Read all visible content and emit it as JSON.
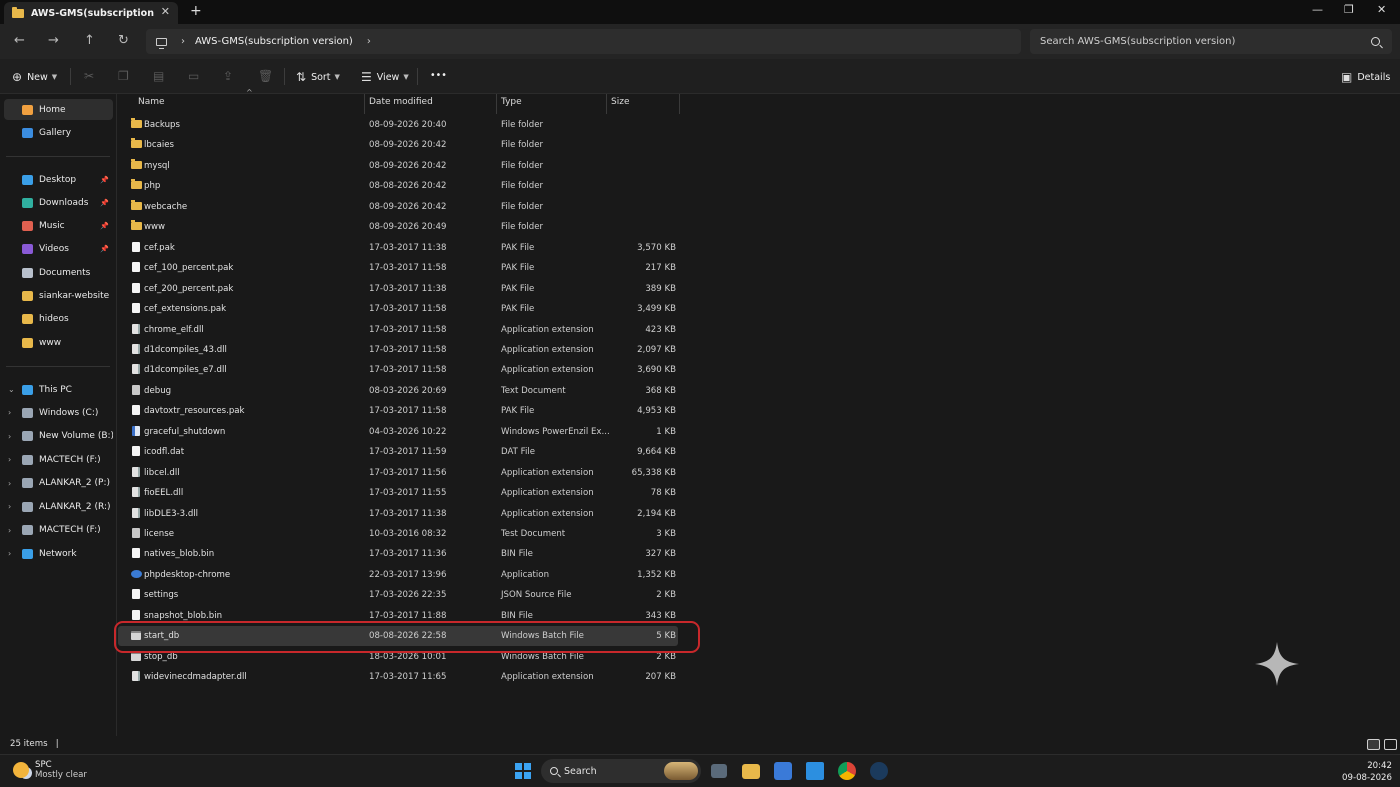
{
  "window": {
    "tab_title": "AWS-GMS(subscription version)",
    "tab_close": "✕",
    "new_tab": "+",
    "minimize": "—",
    "maximize": "❐",
    "close": "✕"
  },
  "address": {
    "path": "AWS-GMS(subscription version)",
    "search_placeholder": "Search AWS-GMS(subscription version)"
  },
  "commandbar": {
    "new_label": "New",
    "sort_label": "Sort",
    "view_label": "View",
    "more_label": "•••",
    "details_label": "Details"
  },
  "sidebar": {
    "quick": [
      {
        "label": "Home",
        "icon": "home-icon",
        "color": "#f0a040"
      },
      {
        "label": "Gallery",
        "icon": "gallery-icon",
        "color": "#3b8de0"
      }
    ],
    "pinned": [
      {
        "label": "Desktop",
        "icon": "desktop-icon",
        "color": "#3a9fe8",
        "pinned": true
      },
      {
        "label": "Downloads",
        "icon": "downloads-icon",
        "color": "#30b0a0",
        "pinned": true
      },
      {
        "label": "Music",
        "icon": "music-icon",
        "color": "#e06050",
        "pinned": true
      },
      {
        "label": "Videos",
        "icon": "videos-icon",
        "color": "#8a5ad6",
        "pinned": true
      },
      {
        "label": "Documents",
        "icon": "documents-icon",
        "color": "#b8c0cc",
        "pinned": false
      },
      {
        "label": "siankar-website",
        "icon": "folder-icon",
        "color": "#e8b84a",
        "pinned": false
      },
      {
        "label": "hideos",
        "icon": "folder-icon",
        "color": "#e8b84a",
        "pinned": false
      },
      {
        "label": "www",
        "icon": "folder-icon",
        "color": "#e8b84a",
        "pinned": false
      }
    ],
    "this_pc": {
      "label": "This PC",
      "icon": "pc-icon",
      "color": "#3a9fe8"
    },
    "drives": [
      {
        "label": "Windows (C:)",
        "icon": "drive-icon",
        "color": "#9aa6b4"
      },
      {
        "label": "New Volume (B:)",
        "icon": "drive-icon",
        "color": "#9aa6b4"
      },
      {
        "label": "MACTECH (F:)",
        "icon": "drive-icon",
        "color": "#9aa6b4"
      },
      {
        "label": "ALANKAR_2 (P:)",
        "icon": "drive-icon",
        "color": "#9aa6b4"
      }
    ],
    "roots": [
      {
        "label": "ALANKAR_2 (R:)",
        "icon": "drive-icon",
        "color": "#9aa6b4"
      },
      {
        "label": "MACTECH (F:)",
        "icon": "drive-icon",
        "color": "#9aa6b4"
      },
      {
        "label": "Network",
        "icon": "network-icon",
        "color": "#3a9fe8"
      }
    ]
  },
  "columns": {
    "name": "Name",
    "date": "Date modified",
    "type": "Type",
    "size": "Size"
  },
  "files": [
    {
      "name": "Backups",
      "date": "08-09-2026 20:40",
      "type": "File folder",
      "size": "",
      "kind": "folder"
    },
    {
      "name": "lbcaies",
      "date": "08-09-2026 20:42",
      "type": "File folder",
      "size": "",
      "kind": "folder"
    },
    {
      "name": "mysql",
      "date": "08-09-2026 20:42",
      "type": "File folder",
      "size": "",
      "kind": "folder"
    },
    {
      "name": "php",
      "date": "08-08-2026 20:42",
      "type": "File folder",
      "size": "",
      "kind": "folder"
    },
    {
      "name": "webcache",
      "date": "08-09-2026 20:42",
      "type": "File folder",
      "size": "",
      "kind": "folder"
    },
    {
      "name": "www",
      "date": "08-09-2026 20:49",
      "type": "File folder",
      "size": "",
      "kind": "folder"
    },
    {
      "name": "cef.pak",
      "date": "17-03-2017 11:38",
      "type": "PAK File",
      "size": "3,570 KB",
      "kind": "file"
    },
    {
      "name": "cef_100_percent.pak",
      "date": "17-03-2017 11:58",
      "type": "PAK File",
      "size": "217 KB",
      "kind": "file"
    },
    {
      "name": "cef_200_percent.pak",
      "date": "17-03-2017 11:38",
      "type": "PAK File",
      "size": "389 KB",
      "kind": "file"
    },
    {
      "name": "cef_extensions.pak",
      "date": "17-03-2017 11:58",
      "type": "PAK File",
      "size": "3,499 KB",
      "kind": "file"
    },
    {
      "name": "chrome_elf.dll",
      "date": "17-03-2017 11:58",
      "type": "Application extension",
      "size": "423 KB",
      "kind": "dll"
    },
    {
      "name": "d1dcompiles_43.dll",
      "date": "17-03-2017 11:58",
      "type": "Application extension",
      "size": "2,097 KB",
      "kind": "dll"
    },
    {
      "name": "d1dcompiles_e7.dll",
      "date": "17-03-2017 11:58",
      "type": "Application extension",
      "size": "3,690 KB",
      "kind": "dll"
    },
    {
      "name": "debug",
      "date": "08-03-2026 20:69",
      "type": "Text Document",
      "size": "368 KB",
      "kind": "text"
    },
    {
      "name": "davtoxtr_resources.pak",
      "date": "17-03-2017 11:58",
      "type": "PAK File",
      "size": "4,953 KB",
      "kind": "file"
    },
    {
      "name": "graceful_shutdown",
      "date": "04-03-2026 10:22",
      "type": "Windows PowerEnzil Ex...",
      "size": "1 KB",
      "kind": "ps"
    },
    {
      "name": "icodfl.dat",
      "date": "17-03-2017 11:59",
      "type": "DAT File",
      "size": "9,664 KB",
      "kind": "file"
    },
    {
      "name": "libcel.dll",
      "date": "17-03-2017 11:56",
      "type": "Application extension",
      "size": "65,338 KB",
      "kind": "dll"
    },
    {
      "name": "fioEEL.dll",
      "date": "17-03-2017 11:55",
      "type": "Application extension",
      "size": "78 KB",
      "kind": "dll"
    },
    {
      "name": "libDLE3-3.dll",
      "date": "17-03-2017 11:38",
      "type": "Application extension",
      "size": "2,194 KB",
      "kind": "dll"
    },
    {
      "name": "license",
      "date": "10-03-2016 08:32",
      "type": "Test Document",
      "size": "3 KB",
      "kind": "text"
    },
    {
      "name": "natives_blob.bin",
      "date": "17-03-2017 11:36",
      "type": "BIN File",
      "size": "327 KB",
      "kind": "file"
    },
    {
      "name": "phpdesktop-chrome",
      "date": "22-03-2017 13:96",
      "type": "Application",
      "size": "1,352 KB",
      "kind": "app"
    },
    {
      "name": "settings",
      "date": "17-03-2026 22:35",
      "type": "JSON Source File",
      "size": "2 KB",
      "kind": "file"
    },
    {
      "name": "snapshot_blob.bin",
      "date": "17-03-2017 11:88",
      "type": "BIN File",
      "size": "343 KB",
      "kind": "file"
    },
    {
      "name": "start_db",
      "date": "08-08-2026 22:58",
      "type": "Windows Batch File",
      "size": "5 KB",
      "kind": "bat",
      "selected": true
    },
    {
      "name": "stop_db",
      "date": "18-03-2026 10:01",
      "type": "Windows Batch File",
      "size": "2 KB",
      "kind": "bat"
    },
    {
      "name": "widevinecdmadapter.dll",
      "date": "17-03-2017 11:65",
      "type": "Application extension",
      "size": "207 KB",
      "kind": "dll"
    }
  ],
  "status": {
    "item_count": "25 items",
    "cursor": "|"
  },
  "taskbar": {
    "weather_title": "SPC",
    "weather_desc": "Mostly clear",
    "search_label": "Search",
    "time": "20:42",
    "date": "09-08-2026"
  },
  "colors": {
    "accent": "#3ba3f2",
    "folder": "#e8b84a",
    "highlight_ring": "#c8282b"
  }
}
